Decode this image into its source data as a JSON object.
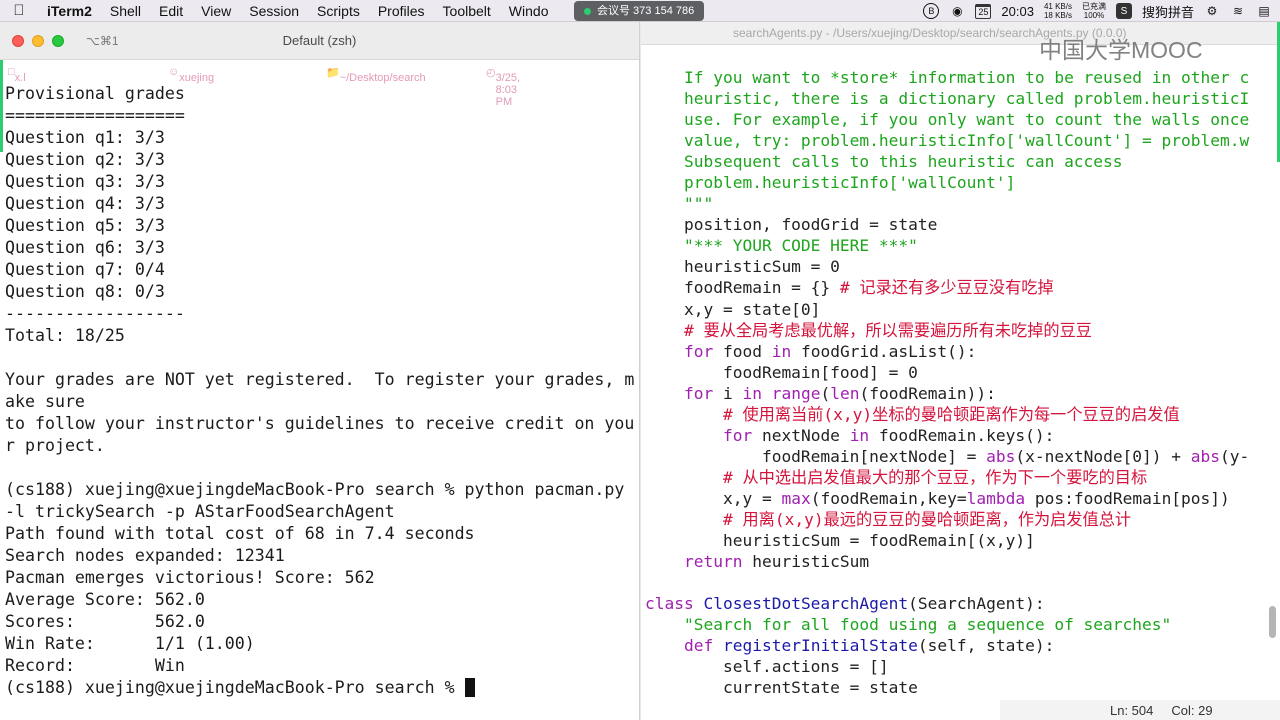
{
  "menubar": {
    "app_name": "iTerm2",
    "items": [
      "Shell",
      "Edit",
      "View",
      "Session",
      "Scripts",
      "Profiles",
      "Toolbelt",
      "Windo"
    ],
    "meeting": "会议号 373 154 786",
    "cal_day": "25",
    "time": "20:03",
    "net_up": "41 KB/s",
    "net_down": "18 KB/s",
    "battery_status": "已充满",
    "battery": "100%",
    "ime": "搜狗拼音"
  },
  "terminal": {
    "shortcut": "⌥⌘1",
    "title": "Default (zsh)",
    "info": {
      "user_host": "x.l",
      "user": "xuejing",
      "path": "~/Desktop/search",
      "datetime": "3/25, 8:03 PM"
    },
    "lines": [
      "Provisional grades",
      "==================",
      "Question q1: 3/3",
      "Question q2: 3/3",
      "Question q3: 3/3",
      "Question q4: 3/3",
      "Question q5: 3/3",
      "Question q6: 3/3",
      "Question q7: 0/4",
      "Question q8: 0/3",
      "------------------",
      "Total: 18/25",
      "",
      "Your grades are NOT yet registered.  To register your grades, m",
      "ake sure",
      "to follow your instructor's guidelines to receive credit on you",
      "r project.",
      "",
      "(cs188) xuejing@xuejingdeMacBook-Pro search % python pacman.py",
      "-l trickySearch -p AStarFoodSearchAgent",
      "Path found with total cost of 68 in 7.4 seconds",
      "Search nodes expanded: 12341",
      "Pacman emerges victorious! Score: 562",
      "Average Score: 562.0",
      "Scores:        562.0",
      "Win Rate:      1/1 (1.00)",
      "Record:        Win"
    ],
    "prompt": "(cs188) xuejing@xuejingdeMacBook-Pro search % "
  },
  "editor": {
    "title": "searchAgents.py - /Users/xuejing/Desktop/search/searchAgents.py (0.0.0)",
    "watermark": "中国大学MOOC",
    "status_line": "Ln: 504",
    "status_col": "Col: 29",
    "code": [
      [
        {
          "t": "    "
        },
        {
          "c": "str",
          "t": "If you want to *store* information to be reused in other c"
        }
      ],
      [
        {
          "t": "    "
        },
        {
          "c": "str",
          "t": "heuristic, there is a dictionary called problem.heuristicI"
        }
      ],
      [
        {
          "t": "    "
        },
        {
          "c": "str",
          "t": "use. For example, if you only want to count the walls once"
        }
      ],
      [
        {
          "t": "    "
        },
        {
          "c": "str",
          "t": "value, try: problem.heuristicInfo['wallCount'] = problem.w"
        }
      ],
      [
        {
          "t": "    "
        },
        {
          "c": "str",
          "t": "Subsequent calls to this heuristic can access"
        }
      ],
      [
        {
          "t": "    "
        },
        {
          "c": "str",
          "t": "problem.heuristicInfo['wallCount']"
        }
      ],
      [
        {
          "t": "    "
        },
        {
          "c": "str",
          "t": "\"\"\""
        }
      ],
      [
        {
          "t": "    position, foodGrid = state"
        }
      ],
      [
        {
          "t": "    "
        },
        {
          "c": "str",
          "t": "\"*** YOUR CODE HERE ***\""
        }
      ],
      [
        {
          "t": "    heuristicSum = 0"
        }
      ],
      [
        {
          "t": "    foodRemain = {} "
        },
        {
          "c": "cmt",
          "t": "# 记录还有多少豆豆没有吃掉"
        }
      ],
      [
        {
          "t": "    x,y = state[0]"
        }
      ],
      [
        {
          "t": "    "
        },
        {
          "c": "cmt",
          "t": "# 要从全局考虑最优解，所以需要遍历所有未吃掉的豆豆"
        }
      ],
      [
        {
          "t": "    "
        },
        {
          "c": "kw",
          "t": "for"
        },
        {
          "t": " food "
        },
        {
          "c": "kw",
          "t": "in"
        },
        {
          "t": " foodGrid.asList():"
        }
      ],
      [
        {
          "t": "        foodRemain[food] = 0"
        }
      ],
      [
        {
          "t": "    "
        },
        {
          "c": "kw",
          "t": "for"
        },
        {
          "t": " i "
        },
        {
          "c": "kw",
          "t": "in"
        },
        {
          "t": " "
        },
        {
          "c": "bi",
          "t": "range"
        },
        {
          "t": "("
        },
        {
          "c": "bi",
          "t": "len"
        },
        {
          "t": "(foodRemain)):"
        }
      ],
      [
        {
          "t": "        "
        },
        {
          "c": "cmt",
          "t": "# 使用离当前(x,y)坐标的曼哈顿距离作为每一个豆豆的启发值"
        }
      ],
      [
        {
          "t": "        "
        },
        {
          "c": "kw",
          "t": "for"
        },
        {
          "t": " nextNode "
        },
        {
          "c": "kw",
          "t": "in"
        },
        {
          "t": " foodRemain.keys():"
        }
      ],
      [
        {
          "t": "            foodRemain[nextNode] = "
        },
        {
          "c": "bi",
          "t": "abs"
        },
        {
          "t": "(x-nextNode[0]) + "
        },
        {
          "c": "bi",
          "t": "abs"
        },
        {
          "t": "(y-"
        }
      ],
      [
        {
          "t": "        "
        },
        {
          "c": "cmt",
          "t": "# 从中选出启发值最大的那个豆豆，作为下一个要吃的目标"
        }
      ],
      [
        {
          "t": "        x,y = "
        },
        {
          "c": "bi",
          "t": "max"
        },
        {
          "t": "(foodRemain,key="
        },
        {
          "c": "kw",
          "t": "lambda"
        },
        {
          "t": " pos:foodRemain[pos])"
        }
      ],
      [
        {
          "t": "        "
        },
        {
          "c": "cmt",
          "t": "# 用离(x,y)最远的豆豆的曼哈顿距离，作为启发值总计"
        }
      ],
      [
        {
          "t": "        heuristicSum = foodRemain[(x,y)]"
        }
      ],
      [
        {
          "t": "    "
        },
        {
          "c": "kw",
          "t": "return"
        },
        {
          "t": " heuristicSum"
        }
      ],
      [
        {
          "t": ""
        }
      ],
      [
        {
          "c": "kw",
          "t": "class"
        },
        {
          "t": " "
        },
        {
          "c": "fn",
          "t": "ClosestDotSearchAgent"
        },
        {
          "t": "(SearchAgent):"
        }
      ],
      [
        {
          "t": "    "
        },
        {
          "c": "str",
          "t": "\"Search for all food using a sequence of searches\""
        }
      ],
      [
        {
          "t": "    "
        },
        {
          "c": "kw",
          "t": "def"
        },
        {
          "t": " "
        },
        {
          "c": "fn",
          "t": "registerInitialState"
        },
        {
          "t": "(self, state):"
        }
      ],
      [
        {
          "t": "        self.actions = []"
        }
      ],
      [
        {
          "t": "        currentState = state"
        }
      ]
    ]
  },
  "colors": {
    "string": "#1ea51e",
    "keyword": "#a020b0",
    "comment": "#d4143c",
    "function": "#1a1aa8",
    "accent_green": "#2ecc71"
  }
}
